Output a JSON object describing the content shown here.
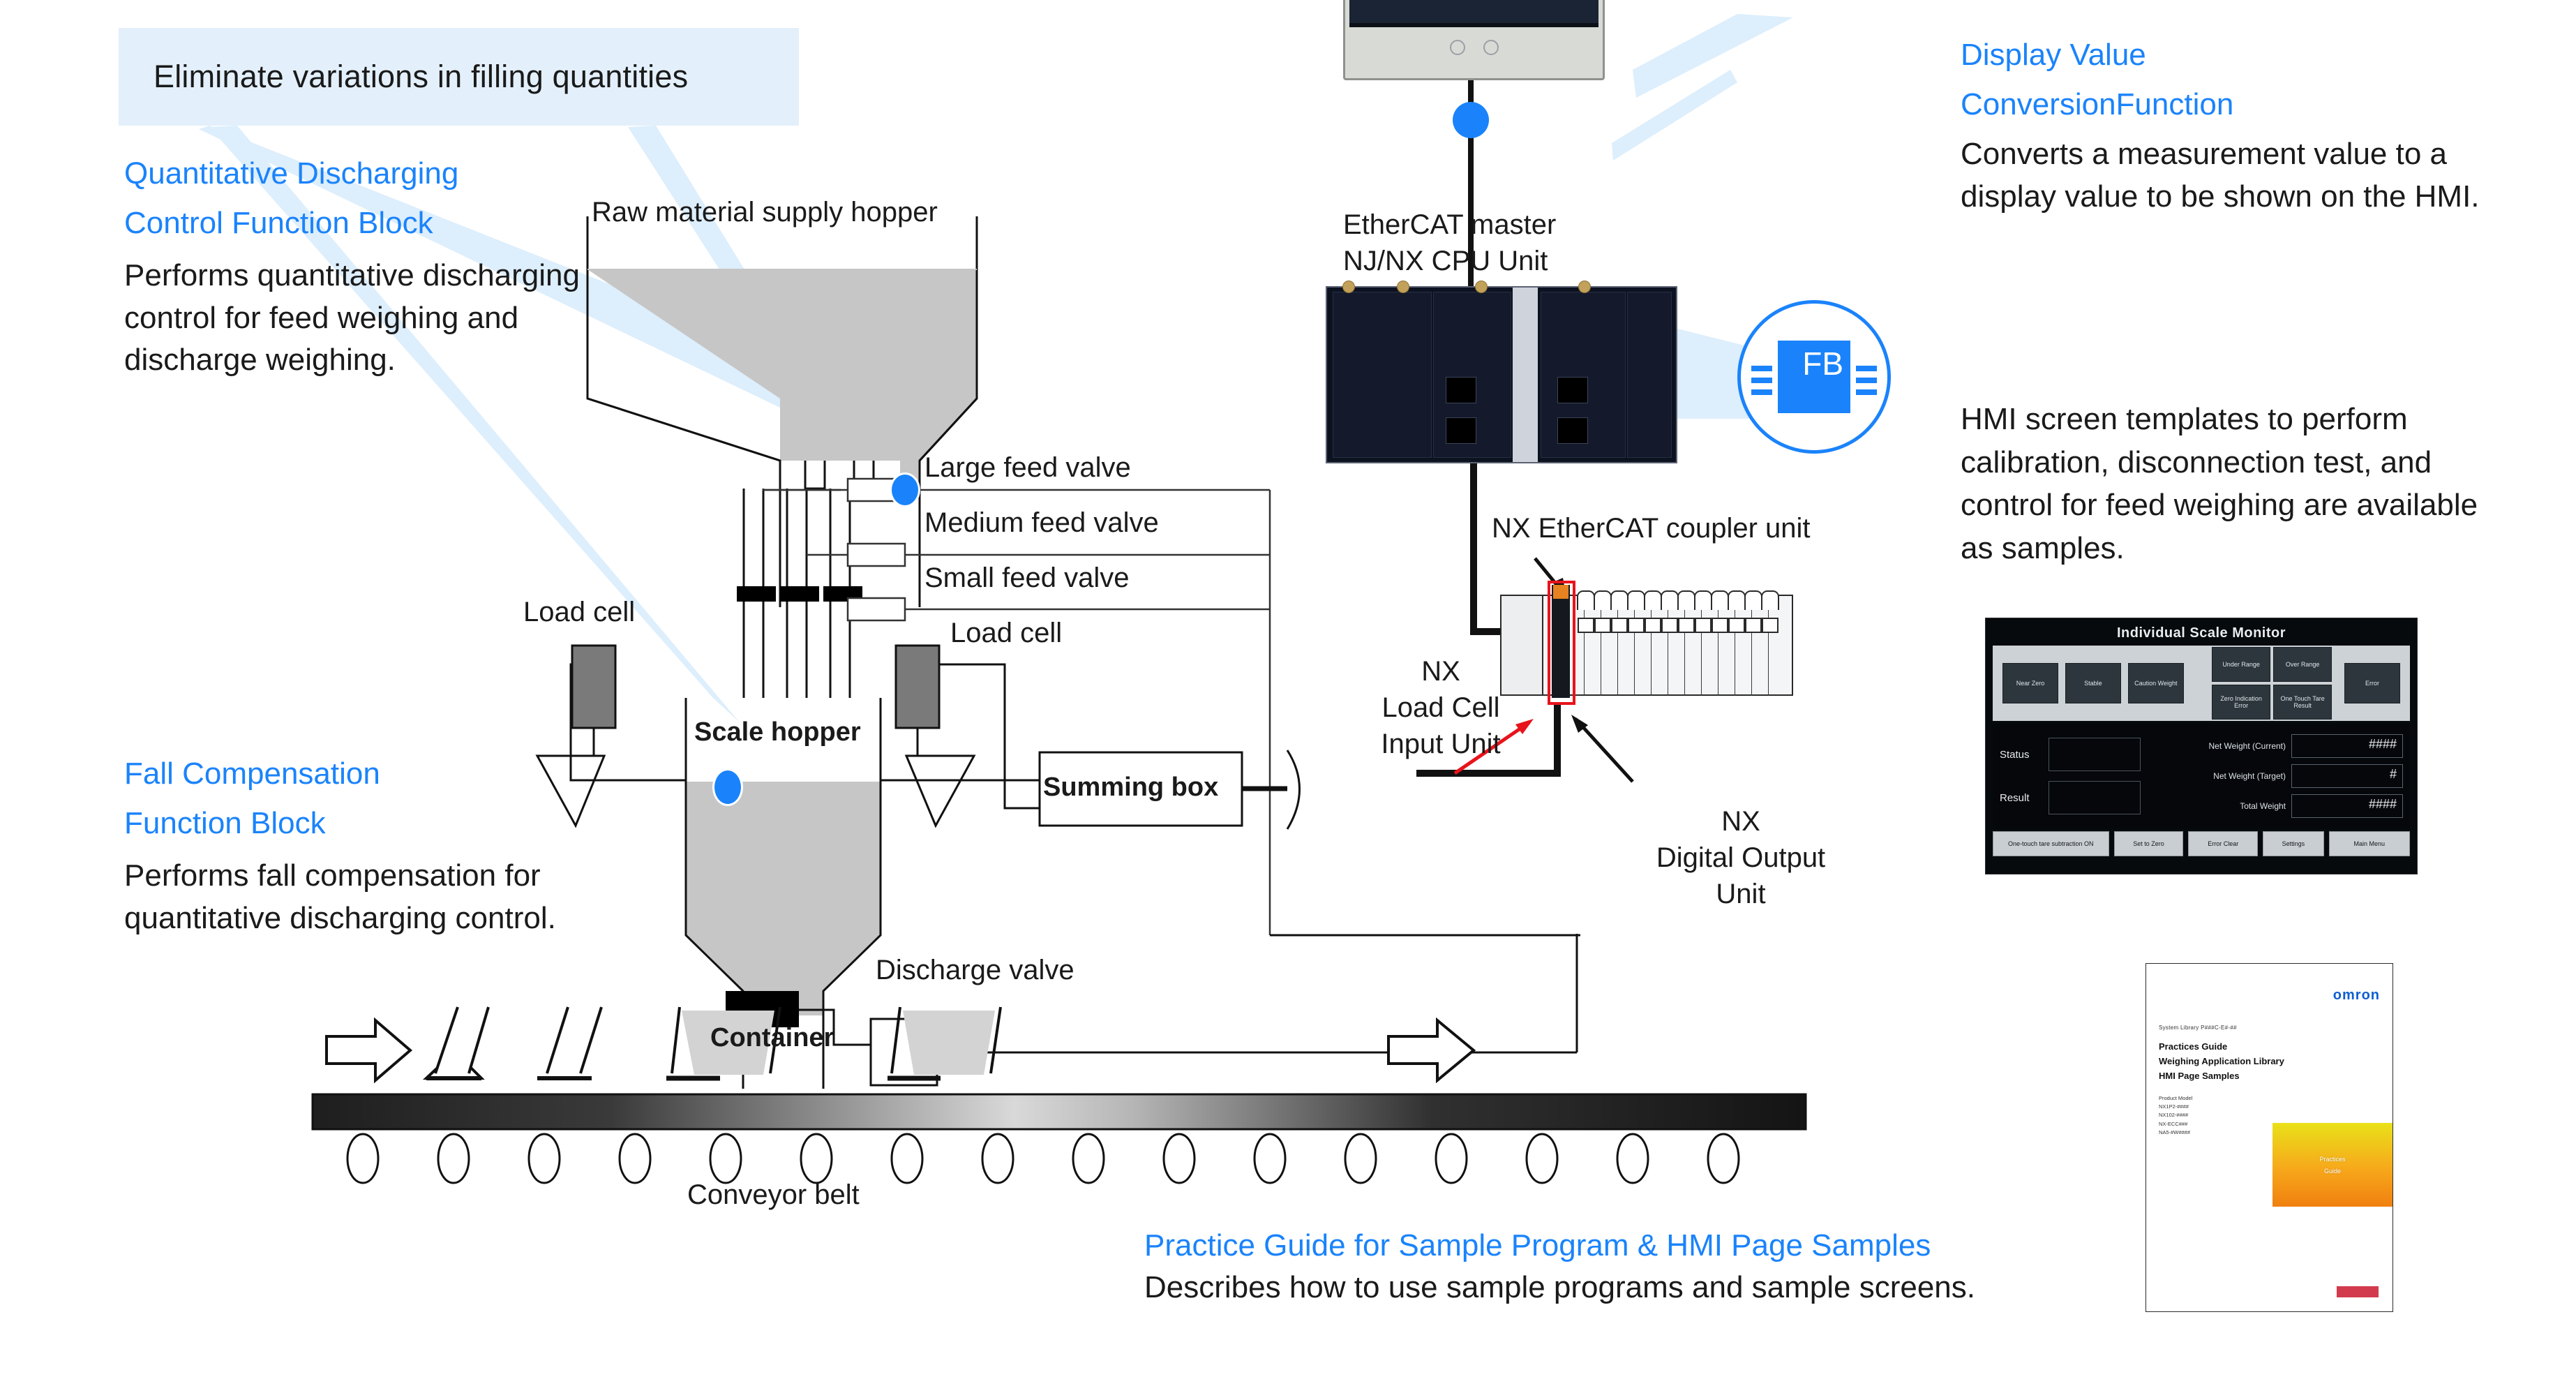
{
  "callout": {
    "banner": "Eliminate variations in filling quantities"
  },
  "left_panels": [
    {
      "id": "quantitative-discharging",
      "heading_line1": "Quantitative Discharging",
      "heading_line2": "Control Function Block",
      "body": "Performs quantitative discharging control for feed weighing and discharge weighing."
    },
    {
      "id": "fall-compensation",
      "heading_line1": "Fall Compensation",
      "heading_line2": "Function Block",
      "body": "Performs fall compensation for quantitative discharging control."
    }
  ],
  "right_panels": {
    "display_value": {
      "heading_line1": "Display Value",
      "heading_line2": "ConversionFunction",
      "body": "Converts a measurement value to a display value to be shown on the HMI."
    },
    "hmi_note": "HMI screen templates to perform calibration, disconnection test, and control for feed weighing are available as samples."
  },
  "bottom_caption": {
    "title": "Practice Guide for Sample Program & HMI Page Samples",
    "subtitle": "Describes how to use sample programs and sample screens."
  },
  "diagram_labels": {
    "raw_material_supply_hopper": "Raw material supply hopper",
    "large_feed_valve": "Large feed valve",
    "medium_feed_valve": "Medium feed valve",
    "small_feed_valve": "Small feed valve",
    "load_cell_left": "Load cell",
    "load_cell_right": "Load cell",
    "scale_hopper": "Scale hopper",
    "summing_box": "Summing box",
    "discharge_valve": "Discharge valve",
    "container": "Container",
    "conveyor_belt": "Conveyor belt",
    "ethercat_master_line1": "EtherCAT master",
    "ethercat_master_line2": "NJ/NX CPU Unit",
    "nx_ethercat_coupler_unit": "NX EtherCAT coupler unit",
    "nx_load_cell_input_unit_line1": "NX",
    "nx_load_cell_input_unit_line2": "Load Cell",
    "nx_load_cell_input_unit_line3": "Input Unit",
    "nx_digital_output_unit_line1": "NX",
    "nx_digital_output_unit_line2": "Digital Output",
    "nx_digital_output_unit_line3": "Unit"
  },
  "fb_badge": {
    "label": "FB"
  },
  "hmi_screen": {
    "title": "Individual Scale Monitor",
    "lamps_left": [
      "Near Zero",
      "Stable",
      "Caution Weight"
    ],
    "lamps_right_top": [
      "Under Range",
      "Over Range"
    ],
    "lamps_right_bottom": [
      "Zero Indication Error",
      "One Touch Tare Result"
    ],
    "lamp_error": "Error",
    "status_labels": [
      "Status",
      "Result"
    ],
    "values": [
      {
        "label": "Net Weight (Current)",
        "value": "####"
      },
      {
        "label": "Net Weight (Target)",
        "value": "#"
      },
      {
        "label": "Total Weight",
        "value": "####"
      }
    ],
    "buttons": [
      "One-touch tare subtraction ON",
      "Set to Zero",
      "Error Clear",
      "Settings",
      "Main Menu"
    ]
  },
  "guide_cover": {
    "brand": "omron",
    "cat_no": "System Library P###C-E#-##",
    "title_line1": "Practices Guide",
    "title_line2": "Weighing Application Library",
    "title_line3": "HMI Page Samples",
    "models": "Product Model\nNX1P2-####\nNX102-####\nNX-ECC###\nNA5-#W####",
    "badge_line1": "Practices",
    "badge_line2": "Guide"
  },
  "colors": {
    "accent_blue": "#1a83fb",
    "banner_bg": "#e3f0fb",
    "material_gray": "#c6c6c6",
    "load_cell_gray": "#7a7a7a",
    "highlight_red": "#e8131b"
  }
}
